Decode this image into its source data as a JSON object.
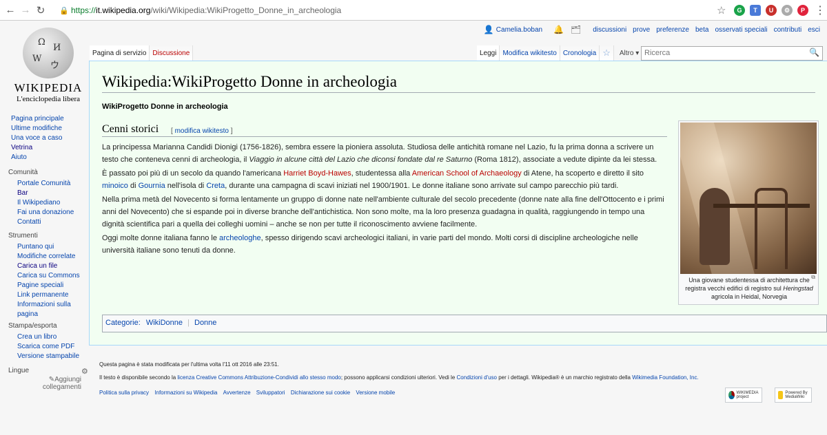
{
  "browser": {
    "url_proto": "https://",
    "url_host": "it.wikipedia.org",
    "url_path": "/wiki/Wikipedia:WikiProgetto_Donne_in_archeologia"
  },
  "logo": {
    "title": "WIKIPEDIA",
    "subtitle": "L'enciclopedia libera"
  },
  "nav_main": [
    "Pagina principale",
    "Ultime modifiche",
    "Una voce a caso",
    "Vetrina",
    "Aiuto"
  ],
  "comunita": {
    "heading": "Comunità",
    "items": [
      "Portale Comunità",
      "Bar",
      "Il Wikipediano",
      "Fai una donazione",
      "Contatti"
    ]
  },
  "strumenti": {
    "heading": "Strumenti",
    "items": [
      "Puntano qui",
      "Modifiche correlate",
      "Carica un file",
      "Carica su Commons",
      "Pagine speciali",
      "Link permanente",
      "Informazioni sulla pagina"
    ]
  },
  "stampa": {
    "heading": "Stampa/esporta",
    "items": [
      "Crea un libro",
      "Scarica come PDF",
      "Versione stampabile"
    ]
  },
  "lingue": {
    "heading": "Lingue",
    "add": "Aggiungi collegamenti"
  },
  "personal": {
    "user": "Camelia.boban",
    "links": [
      "discussioni",
      "prove",
      "preferenze",
      "beta",
      "osservati speciali",
      "contributi",
      "esci"
    ]
  },
  "tabs": {
    "page": "Pagina di servizio",
    "talk": "Discussione",
    "read": "Leggi",
    "edit": "Modifica wikitesto",
    "history": "Cronologia",
    "more": "Altro"
  },
  "search": {
    "placeholder": "Ricerca"
  },
  "page": {
    "title": "Wikipedia:WikiProgetto Donne in archeologia",
    "subtitle": "WikiProgetto Donne in archeologia",
    "section": "Cenni storici",
    "edit_open": "[",
    "edit_link": "modifica wikitesto",
    "edit_close": "]",
    "p1": {
      "a": "La principessa Marianna Candidi Dionigi (1756-1826), sembra essere la pioniera assoluta. Studiosa delle antichità romane nel Lazio, fu la prima donna a scrivere un testo che conteneva cenni di archeologia, il ",
      "b": "Viaggio in alcune città del Lazio che diconsi fondate dal re Saturno",
      "c": " (Roma 1812), associate a vedute dipinte da lei stessa."
    },
    "p2": {
      "a": "È passato poi più di un secolo da quando l'americana ",
      "l1": "Harriet Boyd-Hawes",
      "b": ", studentessa alla ",
      "l2": "American School of Archaeology",
      "c": " di Atene, ha scoperto e diretto il sito ",
      "l3": "minoico",
      "d": " di ",
      "l4": "Gournia",
      "e": " nell'isola di ",
      "l5": "Creta",
      "f": ", durante una campagna di scavi iniziati nel 1900/1901. Le donne italiane sono arrivate sul campo parecchio più tardi."
    },
    "p3": "Nella prima metà del Novecento si forma lentamente un gruppo di donne nate nell'ambiente culturale del secolo precedente (donne nate alla fine dell'Ottocento e i primi anni del Novecento) che si espande poi in diverse branche dell'antichistica. Non sono molte, ma la loro presenza guadagna in qualità, raggiungendo in tempo una dignità scientifica pari a quella dei colleghi uomini – anche se non per tutte il riconoscimento avviene facilmente.",
    "p4": {
      "a": "Oggi molte donne italiana fanno le ",
      "l1": "archeologhe",
      "b": ", spesso dirigendo scavi archeologici italiani, in varie parti del mondo. Molti corsi di discipline archeologiche nelle università italiane sono tenuti da donne."
    },
    "caption": {
      "a": "Una giovane studentessa di architettura che registra vecchi edifici di registro sul ",
      "i": "Heringstad",
      "b": " agricola in Heidal, Norvegia"
    },
    "categories": {
      "label": "Categorie:",
      "items": [
        "WikiDonne",
        "Donne"
      ]
    }
  },
  "footer": {
    "modified": "Questa pagina è stata modificata per l'ultima volta l'11 ott 2016 alle 23:51.",
    "license_a": "Il testo è disponibile secondo la ",
    "license_link": "licenza Creative Commons Attribuzione-Condividi allo stesso modo",
    "license_b": "; possono applicarsi condizioni ulteriori. Vedi le ",
    "terms_link": "Condizioni d'uso",
    "license_c": " per i dettagli. Wikipedia® è un marchio registrato della ",
    "foundation_link": "Wikimedia Foundation, Inc.",
    "links": [
      "Politica sulla privacy",
      "Informazioni su Wikipedia",
      "Avvertenze",
      "Sviluppatori",
      "Dichiarazione sui cookie",
      "Versione mobile"
    ],
    "badge_wm": "WIKIMEDIA project",
    "badge_mw": "Powered By MediaWiki"
  },
  "colors": {
    "link": "#0645ad",
    "redlink": "#ba0000",
    "content_bg": "#f2fef2"
  }
}
